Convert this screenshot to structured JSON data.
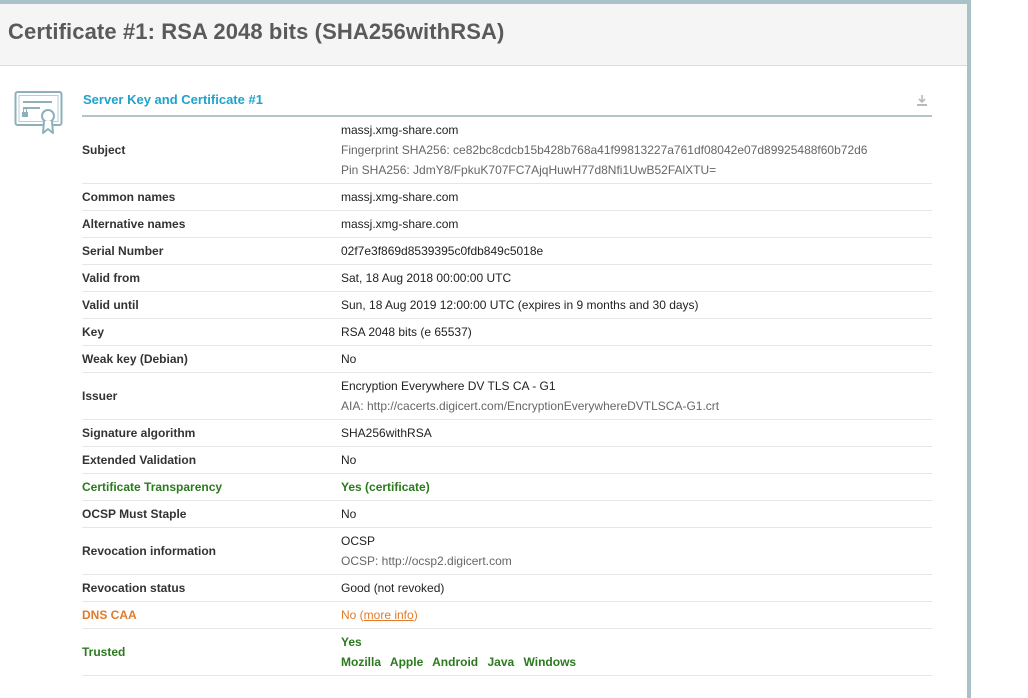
{
  "header": {
    "title": "Certificate #1: RSA 2048 bits (SHA256withRSA)"
  },
  "section": {
    "title": "Server Key and Certificate #1"
  },
  "icons": {
    "certificate": "certificate-icon",
    "download": "download-icon"
  },
  "colors": {
    "accent": "#1fa3cc",
    "green": "#2b7a1e",
    "orange": "#e07b2a"
  },
  "rows": {
    "subject": {
      "label": "Subject",
      "value": "massj.xmg-share.com",
      "fingerprint": "Fingerprint SHA256: ce82bc8cdcb15b428b768a41f99813227a761df08042e07d89925488f60b72d6",
      "pin": "Pin SHA256: JdmY8/FpkuK707FC7AjqHuwH77d8Nfi1UwB52FAlXTU="
    },
    "common_names": {
      "label": "Common names",
      "value": "massj.xmg-share.com"
    },
    "alt_names": {
      "label": "Alternative names",
      "value": "massj.xmg-share.com"
    },
    "serial": {
      "label": "Serial Number",
      "value": "02f7e3f869d8539395c0fdb849c5018e"
    },
    "valid_from": {
      "label": "Valid from",
      "value": "Sat, 18 Aug 2018 00:00:00 UTC"
    },
    "valid_until": {
      "label": "Valid until",
      "value": "Sun, 18 Aug 2019 12:00:00 UTC (expires in 9 months and 30 days)"
    },
    "key": {
      "label": "Key",
      "value": "RSA 2048 bits (e 65537)"
    },
    "weak_key": {
      "label": "Weak key (Debian)",
      "value": "No"
    },
    "issuer": {
      "label": "Issuer",
      "value": "Encryption Everywhere DV TLS CA - G1",
      "aia": "AIA: http://cacerts.digicert.com/EncryptionEverywhereDVTLSCA-G1.crt"
    },
    "sig_alg": {
      "label": "Signature algorithm",
      "value": "SHA256withRSA"
    },
    "ev": {
      "label": "Extended Validation",
      "value": "No"
    },
    "ct": {
      "label": "Certificate Transparency",
      "value": "Yes (certificate)"
    },
    "ocsp_staple": {
      "label": "OCSP Must Staple",
      "value": "No"
    },
    "revocation_info": {
      "label": "Revocation information",
      "value": "OCSP",
      "ocsp": "OCSP: http://ocsp2.digicert.com"
    },
    "revocation_status": {
      "label": "Revocation status",
      "value": "Good (not revoked)"
    },
    "dns_caa": {
      "label": "DNS CAA",
      "value": "No (",
      "link": "more info",
      "suffix": ")"
    },
    "trusted": {
      "label": "Trusted",
      "value": "Yes",
      "platforms": [
        "Mozilla",
        "Apple",
        "Android",
        "Java",
        "Windows"
      ]
    }
  }
}
